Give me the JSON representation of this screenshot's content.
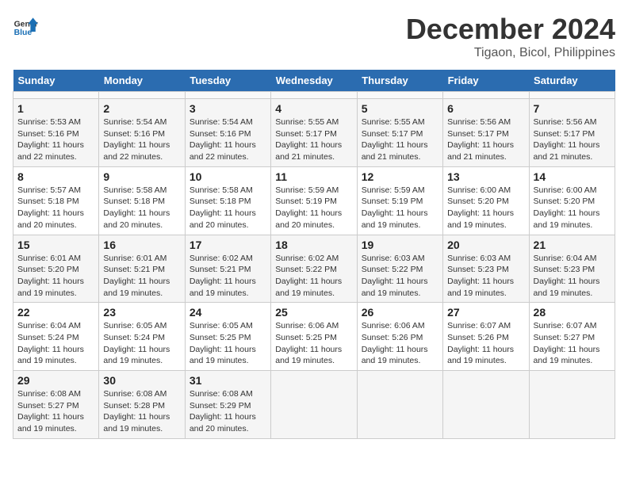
{
  "header": {
    "logo_line1": "General",
    "logo_line2": "Blue",
    "month_title": "December 2024",
    "subtitle": "Tigaon, Bicol, Philippines"
  },
  "calendar": {
    "days_of_week": [
      "Sunday",
      "Monday",
      "Tuesday",
      "Wednesday",
      "Thursday",
      "Friday",
      "Saturday"
    ],
    "weeks": [
      [
        {
          "day": "",
          "content": ""
        },
        {
          "day": "",
          "content": ""
        },
        {
          "day": "",
          "content": ""
        },
        {
          "day": "",
          "content": ""
        },
        {
          "day": "",
          "content": ""
        },
        {
          "day": "",
          "content": ""
        },
        {
          "day": "",
          "content": ""
        }
      ],
      [
        {
          "day": "1",
          "content": "Sunrise: 5:53 AM\nSunset: 5:16 PM\nDaylight: 11 hours\nand 22 minutes."
        },
        {
          "day": "2",
          "content": "Sunrise: 5:54 AM\nSunset: 5:16 PM\nDaylight: 11 hours\nand 22 minutes."
        },
        {
          "day": "3",
          "content": "Sunrise: 5:54 AM\nSunset: 5:16 PM\nDaylight: 11 hours\nand 22 minutes."
        },
        {
          "day": "4",
          "content": "Sunrise: 5:55 AM\nSunset: 5:17 PM\nDaylight: 11 hours\nand 21 minutes."
        },
        {
          "day": "5",
          "content": "Sunrise: 5:55 AM\nSunset: 5:17 PM\nDaylight: 11 hours\nand 21 minutes."
        },
        {
          "day": "6",
          "content": "Sunrise: 5:56 AM\nSunset: 5:17 PM\nDaylight: 11 hours\nand 21 minutes."
        },
        {
          "day": "7",
          "content": "Sunrise: 5:56 AM\nSunset: 5:17 PM\nDaylight: 11 hours\nand 21 minutes."
        }
      ],
      [
        {
          "day": "8",
          "content": "Sunrise: 5:57 AM\nSunset: 5:18 PM\nDaylight: 11 hours\nand 20 minutes."
        },
        {
          "day": "9",
          "content": "Sunrise: 5:58 AM\nSunset: 5:18 PM\nDaylight: 11 hours\nand 20 minutes."
        },
        {
          "day": "10",
          "content": "Sunrise: 5:58 AM\nSunset: 5:18 PM\nDaylight: 11 hours\nand 20 minutes."
        },
        {
          "day": "11",
          "content": "Sunrise: 5:59 AM\nSunset: 5:19 PM\nDaylight: 11 hours\nand 20 minutes."
        },
        {
          "day": "12",
          "content": "Sunrise: 5:59 AM\nSunset: 5:19 PM\nDaylight: 11 hours\nand 19 minutes."
        },
        {
          "day": "13",
          "content": "Sunrise: 6:00 AM\nSunset: 5:20 PM\nDaylight: 11 hours\nand 19 minutes."
        },
        {
          "day": "14",
          "content": "Sunrise: 6:00 AM\nSunset: 5:20 PM\nDaylight: 11 hours\nand 19 minutes."
        }
      ],
      [
        {
          "day": "15",
          "content": "Sunrise: 6:01 AM\nSunset: 5:20 PM\nDaylight: 11 hours\nand 19 minutes."
        },
        {
          "day": "16",
          "content": "Sunrise: 6:01 AM\nSunset: 5:21 PM\nDaylight: 11 hours\nand 19 minutes."
        },
        {
          "day": "17",
          "content": "Sunrise: 6:02 AM\nSunset: 5:21 PM\nDaylight: 11 hours\nand 19 minutes."
        },
        {
          "day": "18",
          "content": "Sunrise: 6:02 AM\nSunset: 5:22 PM\nDaylight: 11 hours\nand 19 minutes."
        },
        {
          "day": "19",
          "content": "Sunrise: 6:03 AM\nSunset: 5:22 PM\nDaylight: 11 hours\nand 19 minutes."
        },
        {
          "day": "20",
          "content": "Sunrise: 6:03 AM\nSunset: 5:23 PM\nDaylight: 11 hours\nand 19 minutes."
        },
        {
          "day": "21",
          "content": "Sunrise: 6:04 AM\nSunset: 5:23 PM\nDaylight: 11 hours\nand 19 minutes."
        }
      ],
      [
        {
          "day": "22",
          "content": "Sunrise: 6:04 AM\nSunset: 5:24 PM\nDaylight: 11 hours\nand 19 minutes."
        },
        {
          "day": "23",
          "content": "Sunrise: 6:05 AM\nSunset: 5:24 PM\nDaylight: 11 hours\nand 19 minutes."
        },
        {
          "day": "24",
          "content": "Sunrise: 6:05 AM\nSunset: 5:25 PM\nDaylight: 11 hours\nand 19 minutes."
        },
        {
          "day": "25",
          "content": "Sunrise: 6:06 AM\nSunset: 5:25 PM\nDaylight: 11 hours\nand 19 minutes."
        },
        {
          "day": "26",
          "content": "Sunrise: 6:06 AM\nSunset: 5:26 PM\nDaylight: 11 hours\nand 19 minutes."
        },
        {
          "day": "27",
          "content": "Sunrise: 6:07 AM\nSunset: 5:26 PM\nDaylight: 11 hours\nand 19 minutes."
        },
        {
          "day": "28",
          "content": "Sunrise: 6:07 AM\nSunset: 5:27 PM\nDaylight: 11 hours\nand 19 minutes."
        }
      ],
      [
        {
          "day": "29",
          "content": "Sunrise: 6:08 AM\nSunset: 5:27 PM\nDaylight: 11 hours\nand 19 minutes."
        },
        {
          "day": "30",
          "content": "Sunrise: 6:08 AM\nSunset: 5:28 PM\nDaylight: 11 hours\nand 19 minutes."
        },
        {
          "day": "31",
          "content": "Sunrise: 6:08 AM\nSunset: 5:29 PM\nDaylight: 11 hours\nand 20 minutes."
        },
        {
          "day": "",
          "content": ""
        },
        {
          "day": "",
          "content": ""
        },
        {
          "day": "",
          "content": ""
        },
        {
          "day": "",
          "content": ""
        }
      ]
    ]
  }
}
